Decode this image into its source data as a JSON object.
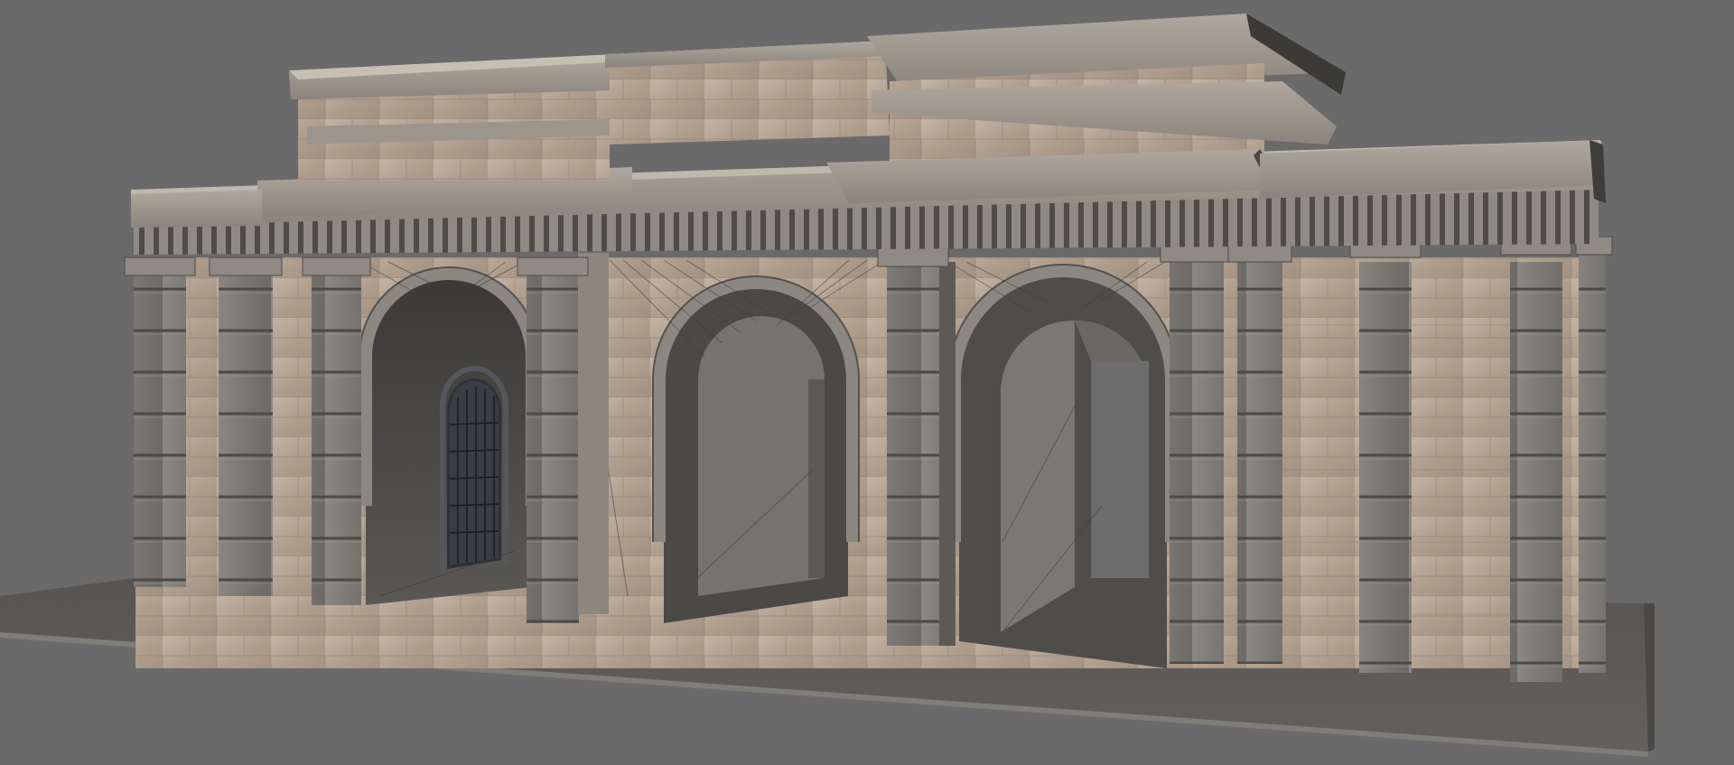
{
  "scene": {
    "subject": "triumphal-arch-3d-model",
    "background_color": "#6a6a6a",
    "ground_color": "#5f5c58",
    "stone_light_color": "#b9a99a",
    "stone_dark_color": "#7d7a76",
    "stone_shadow_color": "#4a4846",
    "icons": [
      "stone-colonnade-model",
      "wireframe-overlay",
      "iron-gate-door"
    ]
  }
}
